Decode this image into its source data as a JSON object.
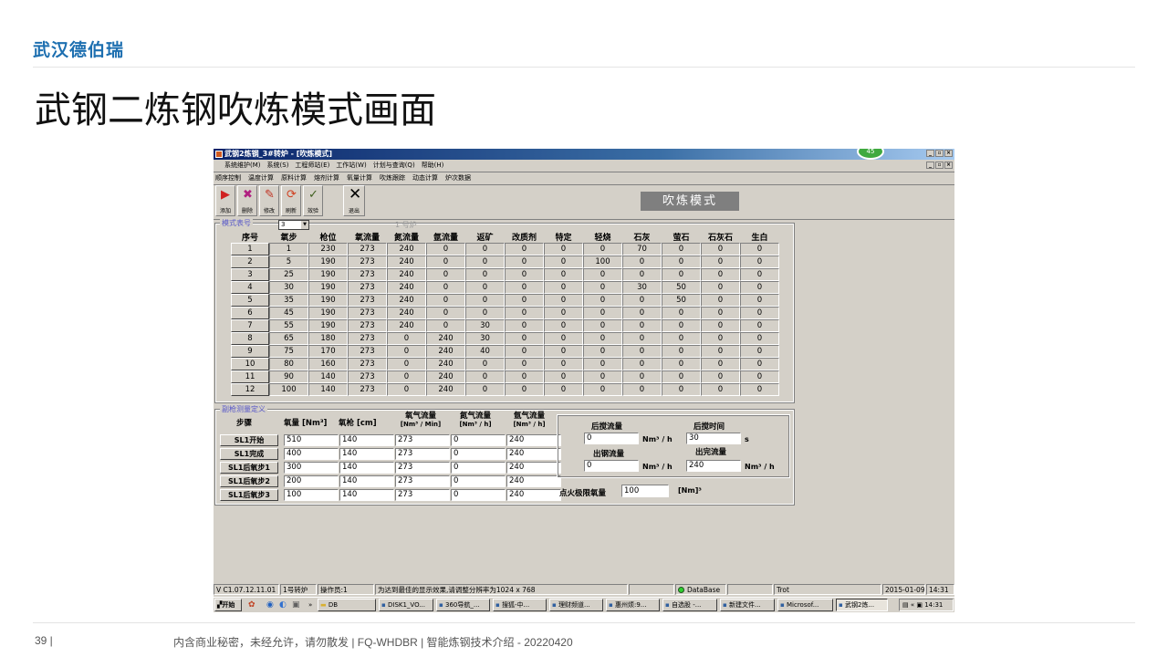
{
  "slide": {
    "logo": "武汉德伯瑞",
    "title": "武钢二炼钢吹炼模式画面",
    "page_number": "39  |",
    "footer": "内含商业秘密，未经允许，请勿散发 | FQ-WHDBR | 智能炼钢技术介绍 - 20220420"
  },
  "window": {
    "title": "武钢2炼钢_3#转炉 - [吹炼模式]",
    "badge": "45",
    "menu": [
      "系统维护(M)",
      "系统(S)",
      "工程师站(E)",
      "工作站(W)",
      "计划与查询(Q)",
      "帮助(H)"
    ],
    "subnav": [
      "顺序控制",
      "温度计算",
      "原料计算",
      "熔剂计算",
      "氧量计算",
      "吹炼跟踪",
      "动态计算",
      "炉次数据"
    ],
    "toolbar": [
      {
        "label": "添加",
        "icon": "add-icon"
      },
      {
        "label": "删除",
        "icon": "delete-icon"
      },
      {
        "label": "修改",
        "icon": "edit-icon"
      },
      {
        "label": "刷新",
        "icon": "refresh-icon"
      },
      {
        "label": "效验",
        "icon": "verify-icon"
      }
    ],
    "exit_label": "退出",
    "mode_title": "吹炼模式"
  },
  "mode_table": {
    "legend": "模式表号",
    "selected_mode": "3",
    "furnace_label": "1 号炉",
    "columns": [
      "序号",
      "氧步",
      "枪位",
      "氧流量",
      "氮流量",
      "氩流量",
      "返矿",
      "改质剂",
      "特定",
      "轻烧",
      "石灰",
      "萤石",
      "石灰石",
      "生白"
    ],
    "rows": [
      [
        "1",
        "1",
        "230",
        "273",
        "240",
        "0",
        "0",
        "0",
        "0",
        "0",
        "70",
        "0",
        "0",
        "0"
      ],
      [
        "2",
        "5",
        "190",
        "273",
        "240",
        "0",
        "0",
        "0",
        "0",
        "100",
        "0",
        "0",
        "0",
        "0"
      ],
      [
        "3",
        "25",
        "190",
        "273",
        "240",
        "0",
        "0",
        "0",
        "0",
        "0",
        "0",
        "0",
        "0",
        "0"
      ],
      [
        "4",
        "30",
        "190",
        "273",
        "240",
        "0",
        "0",
        "0",
        "0",
        "0",
        "30",
        "50",
        "0",
        "0"
      ],
      [
        "5",
        "35",
        "190",
        "273",
        "240",
        "0",
        "0",
        "0",
        "0",
        "0",
        "0",
        "50",
        "0",
        "0"
      ],
      [
        "6",
        "45",
        "190",
        "273",
        "240",
        "0",
        "0",
        "0",
        "0",
        "0",
        "0",
        "0",
        "0",
        "0"
      ],
      [
        "7",
        "55",
        "190",
        "273",
        "240",
        "0",
        "30",
        "0",
        "0",
        "0",
        "0",
        "0",
        "0",
        "0"
      ],
      [
        "8",
        "65",
        "180",
        "273",
        "0",
        "240",
        "30",
        "0",
        "0",
        "0",
        "0",
        "0",
        "0",
        "0"
      ],
      [
        "9",
        "75",
        "170",
        "273",
        "0",
        "240",
        "40",
        "0",
        "0",
        "0",
        "0",
        "0",
        "0",
        "0"
      ],
      [
        "10",
        "80",
        "160",
        "273",
        "0",
        "240",
        "0",
        "0",
        "0",
        "0",
        "0",
        "0",
        "0",
        "0"
      ],
      [
        "11",
        "90",
        "140",
        "273",
        "0",
        "240",
        "0",
        "0",
        "0",
        "0",
        "0",
        "0",
        "0",
        "0"
      ],
      [
        "12",
        "100",
        "140",
        "273",
        "0",
        "240",
        "0",
        "0",
        "0",
        "0",
        "0",
        "0",
        "0",
        "0"
      ]
    ]
  },
  "lance": {
    "legend": "副枪测量定义",
    "headers": {
      "step": "步骤",
      "oxygen": "氧量 [Nm³]",
      "lance": "氧枪 [cm]",
      "o2_flow": "氧气流量",
      "o2_unit": "[Nm³ / Min]",
      "n2_flow": "氮气流量",
      "n2_unit": "[Nm³ / h]",
      "ar_flow": "氩气流量",
      "ar_unit": "[Nm³ / h]"
    },
    "rows": [
      {
        "step": "SL1开始",
        "oxygen": "510",
        "lance": "140",
        "o2": "273",
        "n2": "0",
        "ar": "240"
      },
      {
        "step": "SL1完成",
        "oxygen": "400",
        "lance": "140",
        "o2": "273",
        "n2": "0",
        "ar": "240"
      },
      {
        "step": "SL1后氧步1",
        "oxygen": "300",
        "lance": "140",
        "o2": "273",
        "n2": "0",
        "ar": "240"
      },
      {
        "step": "SL1后氧步2",
        "oxygen": "200",
        "lance": "140",
        "o2": "273",
        "n2": "0",
        "ar": "240"
      },
      {
        "step": "SL1后氧步3",
        "oxygen": "100",
        "lance": "140",
        "o2": "273",
        "n2": "0",
        "ar": "240"
      }
    ],
    "stir_flow_label": "后搅流量",
    "stir_flow": "0",
    "stir_flow_unit": "Nm³ / h",
    "stir_time_label": "后搅时间",
    "stir_time": "30",
    "stir_time_unit": "s",
    "tap_flow_label": "出钢流量",
    "tap_flow": "0",
    "tap_flow_unit": "Nm³ / h",
    "finish_flow_label": "出完流量",
    "finish_flow": "240",
    "finish_flow_unit": "Nm³ / h",
    "ignite_label": "点火极限氧量",
    "ignite_value": "100",
    "ignite_unit": "[Nm]³"
  },
  "status": {
    "version": "V C1.07.12.11.01",
    "furnace": "1号转炉",
    "operator": "操作员:1",
    "hint": "为达到最佳的显示效果,请调整分辨率为1024 x 768",
    "db": "DataBase",
    "user": "Trot",
    "date": "2015-01-09",
    "time": "14:31"
  },
  "taskbar": {
    "start": "开始",
    "folder": "DB",
    "items": [
      "DISK1_VO...",
      "360导航_...",
      "搜狐-中...",
      "理财频道...",
      "惠州烦:9...",
      "自选股 -...",
      "新建文件...",
      "Microsof...",
      "武钢2炼..."
    ],
    "clock": "14:31"
  }
}
